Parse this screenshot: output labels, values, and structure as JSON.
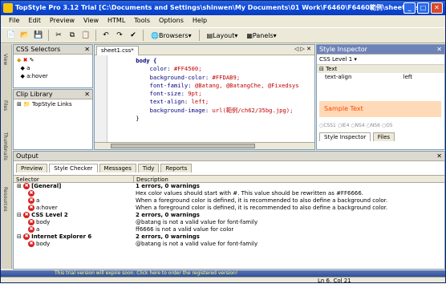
{
  "window": {
    "title": "TopStyle Pro 3.12 Trial  [C:\\Documents and Settings\\shinwen\\My Documents\\01 Work\\F6460\\F6460範例\\sheet1.css]"
  },
  "menu": [
    "File",
    "Edit",
    "Preview",
    "View",
    "HTML",
    "Tools",
    "Options",
    "Help"
  ],
  "toolbar": {
    "browsers": "Browsers",
    "layout": "Layout",
    "panels": "Panels"
  },
  "sidebar_labels": [
    "View",
    "Files",
    "Thumbnails",
    "Resources"
  ],
  "css_selectors": {
    "title": "CSS Selectors",
    "items": [
      "a",
      "a:hover"
    ]
  },
  "clip_library": {
    "title": "Clip Library",
    "items": [
      "TopStyle Links"
    ]
  },
  "editor": {
    "tab": "sheet1.css*",
    "lines": [
      {
        "type": "sel",
        "text": "body {"
      },
      {
        "type": "decl",
        "prop": "color:",
        "val": " #FF4500;"
      },
      {
        "type": "decl",
        "prop": "background-color:",
        "val": " #FFDAB9;"
      },
      {
        "type": "decl",
        "prop": "font-family:",
        "val": " @Batang, @BatangChe, @Fixedsys"
      },
      {
        "type": "decl",
        "prop": "font-size:",
        "val": " 9pt;"
      },
      {
        "type": "decl",
        "prop": "text-align:",
        "val": " left;"
      },
      {
        "type": "decl",
        "prop": "background-image:",
        "val": " url(範例/ch62/35bg.jpg);"
      },
      {
        "type": "close",
        "text": "}"
      }
    ]
  },
  "inspector": {
    "title": "Style Inspector",
    "level": "CSS Level 1",
    "group": "Text",
    "prop": "text-align",
    "value": "left",
    "sample": "Sample Text",
    "options": [
      "CSS1",
      "IE4",
      "NS4",
      "NS6",
      "O5"
    ],
    "bottom_tabs": [
      "Style Inspector",
      "Files"
    ]
  },
  "output": {
    "title": "Output",
    "tabs": [
      "Preview",
      "Style Checker",
      "Messages",
      "Tidy",
      "Reports"
    ],
    "col_selector": "Selector",
    "col_description": "Description",
    "rows": [
      {
        "sel": "[General]",
        "desc": "1 errors, 0 warnings",
        "bold": true,
        "indent": 0,
        "marker": "⊞"
      },
      {
        "sel": "",
        "desc": "Hex color values should start with #.  This value should be rewritten as #FF6666.",
        "bold": false,
        "indent": 1,
        "marker": ""
      },
      {
        "sel": "a",
        "desc": "When a foreground color is defined, it is recommended to also define a background color.",
        "bold": false,
        "indent": 1,
        "marker": ""
      },
      {
        "sel": "a:hover",
        "desc": "When a foreground color is defined, it is recommended to also define a background color.",
        "bold": false,
        "indent": 1,
        "marker": ""
      },
      {
        "sel": "CSS Level 2",
        "desc": "2 errors, 0 warnings",
        "bold": true,
        "indent": 0,
        "marker": "⊟"
      },
      {
        "sel": "body",
        "desc": "@batang is not a valid value for font-family",
        "bold": false,
        "indent": 1,
        "marker": ""
      },
      {
        "sel": "a",
        "desc": "ff6666 is not a valid value for color",
        "bold": false,
        "indent": 1,
        "marker": ""
      },
      {
        "sel": "Internet Explorer 6",
        "desc": "2 errors, 0 warnings",
        "bold": true,
        "indent": 0,
        "marker": "⊟"
      },
      {
        "sel": "body",
        "desc": "@batang is not a valid value for font-family",
        "bold": false,
        "indent": 1,
        "marker": ""
      }
    ]
  },
  "trial": {
    "text": "This trial version will expire soon.  Click here to order the registered version!"
  },
  "status": {
    "position": "Ln 6, Col 21"
  }
}
